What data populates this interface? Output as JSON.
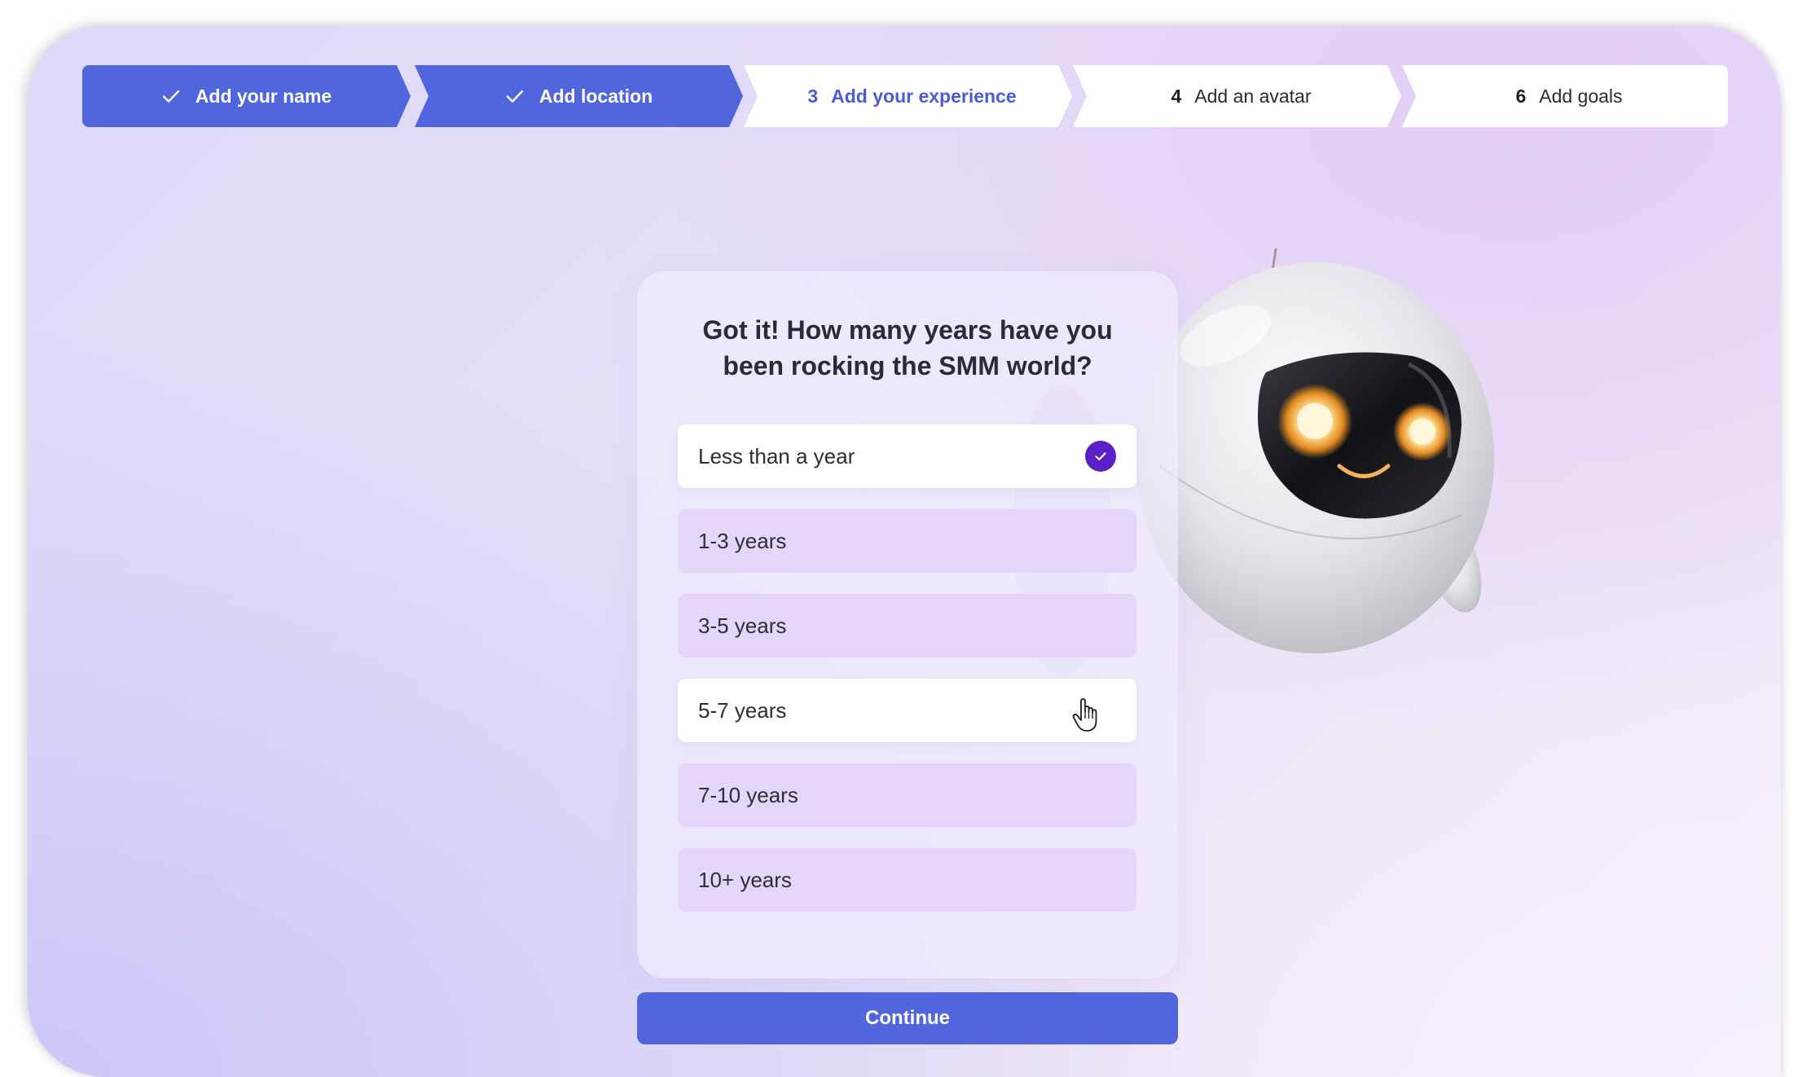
{
  "stepper": {
    "steps": [
      {
        "number": "",
        "label": "Add your name",
        "state": "done"
      },
      {
        "number": "",
        "label": "Add location",
        "state": "done"
      },
      {
        "number": "3",
        "label": "Add your experience",
        "state": "current"
      },
      {
        "number": "4",
        "label": "Add an avatar",
        "state": "todo"
      },
      {
        "number": "6",
        "label": "Add goals",
        "state": "todo"
      }
    ]
  },
  "question": {
    "line1": "Got it! How many years have you",
    "line2": "been rocking the SMM world?"
  },
  "options": [
    {
      "label": "Less than a year",
      "selected": true
    },
    {
      "label": "1-3 years",
      "selected": false
    },
    {
      "label": "3-5 years",
      "selected": false
    },
    {
      "label": "5-7 years",
      "selected": false,
      "hovered": true
    },
    {
      "label": "7-10 years",
      "selected": false
    },
    {
      "label": "10+ years",
      "selected": false
    }
  ],
  "continue_label": "Continue",
  "colors": {
    "primary": "#5165dc",
    "selected_check": "#5a1fc7",
    "option_bg": "#e2d4fa"
  },
  "icons": {
    "step_done": "checkmark-icon",
    "selected_option": "check-circle-icon",
    "cursor": "hand-pointer-icon",
    "mascot": "robot-mascot"
  }
}
